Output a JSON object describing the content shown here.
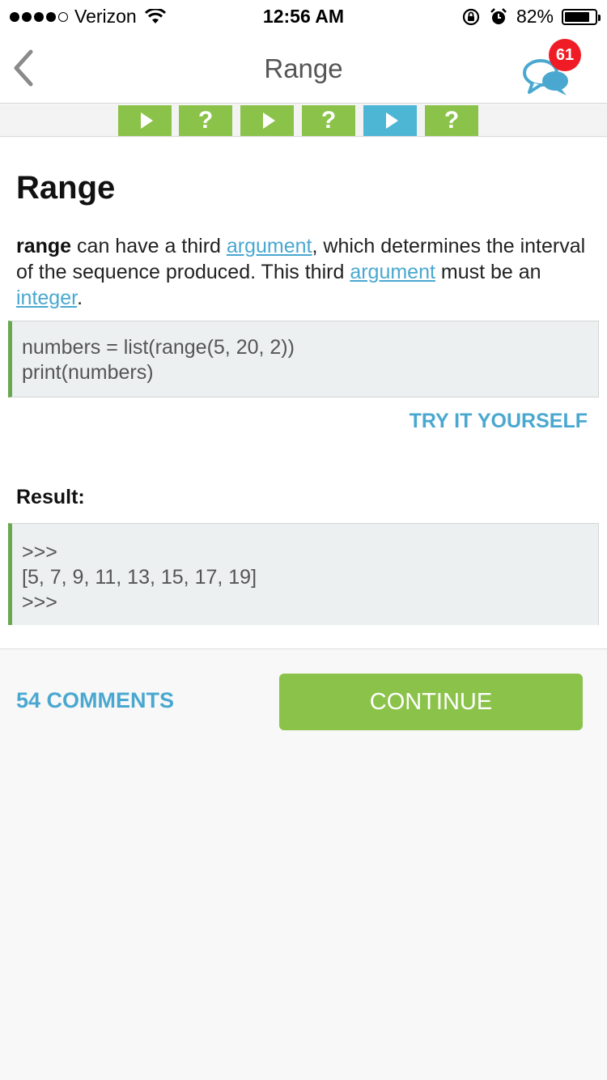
{
  "status_bar": {
    "carrier": "Verizon",
    "time": "12:56 AM",
    "battery_percent": "82%",
    "battery_level": 0.82,
    "icons": [
      "signal-dots-icon",
      "wifi-icon",
      "rotation-lock-icon",
      "alarm-icon",
      "battery-icon"
    ]
  },
  "nav": {
    "title": "Range",
    "back_icon": "chevron-left-icon",
    "chat_icon": "chat-bubbles-icon",
    "badge_count": "61"
  },
  "progress_steps": [
    {
      "kind": "lesson",
      "label": "▶",
      "state": "done"
    },
    {
      "kind": "quiz",
      "label": "?",
      "state": "done"
    },
    {
      "kind": "lesson",
      "label": "▶",
      "state": "done"
    },
    {
      "kind": "quiz",
      "label": "?",
      "state": "done"
    },
    {
      "kind": "lesson",
      "label": "▶",
      "state": "current"
    },
    {
      "kind": "quiz",
      "label": "?",
      "state": "done"
    }
  ],
  "lesson": {
    "title": "Range",
    "p_bold": "range",
    "p_t1": " can have a third ",
    "p_link1": "argument",
    "p_t2": ", which determines the interval of the sequence produced. This third ",
    "p_link2": "argument",
    "p_t3": " must be an ",
    "p_link3": "integer",
    "p_t4": ".",
    "code_lines": [
      "numbers = list(range(5, 20, 2))",
      "print(numbers)"
    ],
    "try_label": "TRY IT YOURSELF",
    "result_label": "Result:",
    "result_lines": [
      ">>>",
      "[5, 7, 9, 11, 13, 15, 17, 19]",
      ">>>"
    ]
  },
  "footer": {
    "comments_label": "54 COMMENTS",
    "continue_label": "CONTINUE"
  },
  "colors": {
    "green": "#8bc34a",
    "blue": "#4db6d4",
    "link": "#4aa8d0",
    "badge": "#ef1c25"
  }
}
